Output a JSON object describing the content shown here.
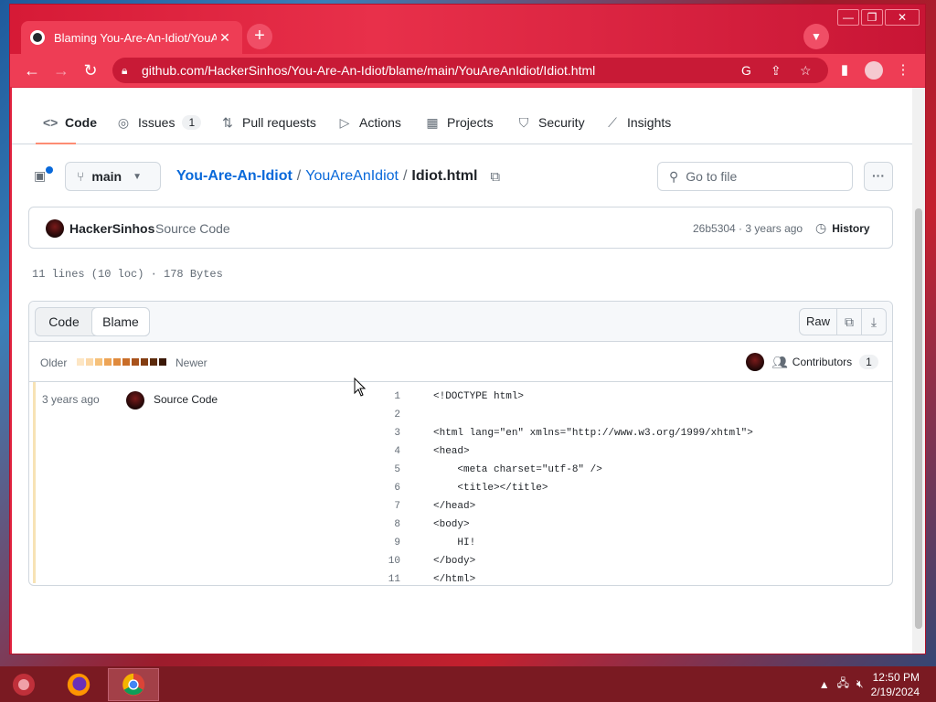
{
  "browser": {
    "tab_title": "Blaming You-Are-An-Idiot/YouAr",
    "url": "github.com/HackerSinhos/You-Are-An-Idiot/blame/main/YouAreAnIdiot/Idiot.html"
  },
  "repo_nav": {
    "tabs": [
      {
        "label": "Code",
        "icon": "code-icon"
      },
      {
        "label": "Issues",
        "icon": "issue-icon",
        "count": "1"
      },
      {
        "label": "Pull requests",
        "icon": "pull-request-icon"
      },
      {
        "label": "Actions",
        "icon": "play-icon"
      },
      {
        "label": "Projects",
        "icon": "table-icon"
      },
      {
        "label": "Security",
        "icon": "shield-icon"
      },
      {
        "label": "Insights",
        "icon": "graph-icon"
      }
    ]
  },
  "file_header": {
    "branch": "main",
    "crumbs": {
      "repo": "You-Are-An-Idiot",
      "folder": "YouAreAnIdiot",
      "file": "Idiot.html"
    },
    "sep": "/",
    "goto_placeholder": "Go to file"
  },
  "commit": {
    "author": "HackerSinhos",
    "message": "Source Code",
    "meta": "26b5304 · 3 years ago",
    "history_label": "History"
  },
  "file_info": "11 lines (10 loc) · 178 Bytes",
  "blame": {
    "view_code": "Code",
    "view_blame": "Blame",
    "raw": "Raw",
    "older": "Older",
    "newer": "Newer",
    "contributors_label": "Contributors",
    "contributors_count": "1",
    "age": "3 years ago",
    "commit_message": "Source Code",
    "swatch_colors": [
      "#fde6c4",
      "#fbd8a8",
      "#f6c17a",
      "#eda456",
      "#e08a3c",
      "#c96d28",
      "#a8521b",
      "#833d12",
      "#5c2a0b",
      "#3a1806"
    ],
    "lines": [
      {
        "n": "1",
        "text": "<!DOCTYPE html>"
      },
      {
        "n": "2",
        "text": ""
      },
      {
        "n": "3",
        "text": "<html lang=\"en\" xmlns=\"http://www.w3.org/1999/xhtml\">"
      },
      {
        "n": "4",
        "text": "<head>"
      },
      {
        "n": "5",
        "text": "    <meta charset=\"utf-8\" />"
      },
      {
        "n": "6",
        "text": "    <title></title>"
      },
      {
        "n": "7",
        "text": "</head>"
      },
      {
        "n": "8",
        "text": "<body>"
      },
      {
        "n": "9",
        "text": "    HI!"
      },
      {
        "n": "10",
        "text": "</body>"
      },
      {
        "n": "11",
        "text": "</html>"
      }
    ]
  },
  "taskbar": {
    "time": "12:50 PM",
    "date": "2/19/2024"
  },
  "colors": {
    "accent_link": "#0969da",
    "tab_underline": "#fd8c73",
    "browser_theme": "#e0233f"
  }
}
